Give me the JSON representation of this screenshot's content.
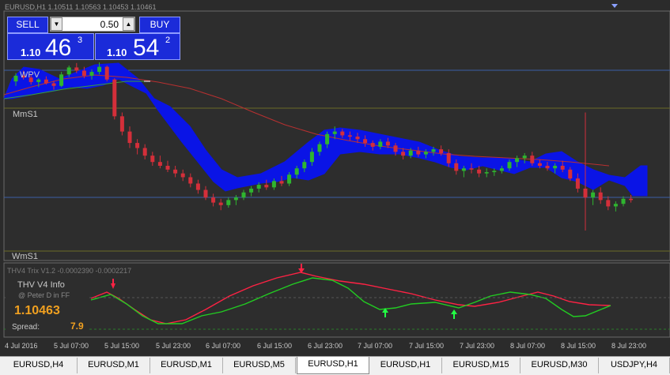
{
  "title": "EURUSD,H1  1.10511 1.10563 1.10453 1.10461",
  "trade_panel": {
    "sell_label": "SELL",
    "buy_label": "BUY",
    "lot_size": "0.50",
    "sell_price": {
      "prefix": "1.10",
      "big": "46",
      "sup": "3"
    },
    "buy_price": {
      "prefix": "1.10",
      "big": "54",
      "sup": "2"
    }
  },
  "levels": {
    "wpv": "WPV",
    "mms1": "MmS1",
    "wms1": "WmS1"
  },
  "indicator": {
    "header": "THV4 Trix V1.2 -0.0002390 -0.0002217",
    "info_title": "THV  V4  Info",
    "info_author": "@ Peter D in FF",
    "price": "1.10463",
    "spread_label": "Spread:",
    "spread_value": "7.9"
  },
  "time_axis": [
    "4 Jul 2016",
    "5 Jul 07:00",
    "5 Jul 15:00",
    "5 Jul 23:00",
    "6 Jul 07:00",
    "6 Jul 15:00",
    "6 Jul 23:00",
    "7 Jul 07:00",
    "7 Jul 15:00",
    "7 Jul 23:00",
    "8 Jul 07:00",
    "8 Jul 15:00",
    "8 Jul 23:00"
  ],
  "tabs": [
    "EURUSD,H4",
    "EURUSD,M1",
    "EURUSD,M1",
    "EURUSD,M5",
    "EURUSD,H1",
    "EURUSD,H1",
    "EURUSD,M15",
    "EURUSD,M30",
    "USDJPY,H4"
  ],
  "active_tab": 4,
  "colors": {
    "bull": "#2fb52f",
    "bear": "#d42f3a",
    "cloud": "#0a14e6",
    "level_line": "#3a5fa8",
    "trix_fast": "#ff2244",
    "trix_slow": "#22cc22"
  },
  "candles": [
    [
      1.1095,
      1.1108,
      1.1088,
      1.1104
    ],
    [
      1.1104,
      1.1112,
      1.1098,
      1.1101
    ],
    [
      1.1101,
      1.1105,
      1.109,
      1.1094
    ],
    [
      1.1094,
      1.11,
      1.1086,
      1.1098
    ],
    [
      1.1098,
      1.1103,
      1.109,
      1.1092
    ],
    [
      1.1092,
      1.1096,
      1.1082,
      1.1088
    ],
    [
      1.1088,
      1.111,
      1.1086,
      1.1106
    ],
    [
      1.1106,
      1.112,
      1.1102,
      1.1117
    ],
    [
      1.1117,
      1.1124,
      1.1108,
      1.1112
    ],
    [
      1.1112,
      1.1118,
      1.11,
      1.1104
    ],
    [
      1.1104,
      1.1114,
      1.1098,
      1.111
    ],
    [
      1.111,
      1.1125,
      1.1106,
      1.1118
    ],
    [
      1.1118,
      1.112,
      1.1095,
      1.1098
    ],
    [
      1.1098,
      1.11,
      1.1035,
      1.104
    ],
    [
      1.104,
      1.1046,
      1.101,
      1.1016
    ],
    [
      1.1016,
      1.1024,
      1.099,
      1.0998
    ],
    [
      1.0998,
      1.1004,
      1.098,
      1.099
    ],
    [
      1.099,
      1.0996,
      1.0972,
      1.0978
    ],
    [
      1.0978,
      1.0984,
      1.0962,
      1.0968
    ],
    [
      1.0968,
      1.0978,
      1.0958,
      1.0962
    ],
    [
      1.0962,
      1.097,
      1.0952,
      1.0956
    ],
    [
      1.0956,
      1.0962,
      1.0944,
      1.095
    ],
    [
      1.095,
      1.0956,
      1.0938,
      1.0944
    ],
    [
      1.0944,
      1.095,
      1.0928,
      1.0934
    ],
    [
      1.0934,
      1.094,
      1.0918,
      1.0924
    ],
    [
      1.0924,
      1.093,
      1.0908,
      1.0912
    ],
    [
      1.0912,
      1.0918,
      1.0898,
      1.0904
    ],
    [
      1.0904,
      1.091,
      1.0892,
      1.09
    ],
    [
      1.09,
      1.0912,
      1.0896,
      1.0908
    ],
    [
      1.0908,
      1.0916,
      1.09,
      1.0912
    ],
    [
      1.0912,
      1.0924,
      1.0908,
      1.092
    ],
    [
      1.092,
      1.093,
      1.0914,
      1.0926
    ],
    [
      1.0926,
      1.0936,
      1.092,
      1.0932
    ],
    [
      1.0932,
      1.094,
      1.0924,
      1.0928
    ],
    [
      1.0928,
      1.0942,
      1.0924,
      1.0938
    ],
    [
      1.0938,
      1.0946,
      1.093,
      1.0934
    ],
    [
      1.0934,
      1.0952,
      1.093,
      1.0948
    ],
    [
      1.0948,
      1.0962,
      1.0942,
      1.0958
    ],
    [
      1.0958,
      1.0972,
      1.0952,
      1.0968
    ],
    [
      1.0968,
      1.099,
      1.0962,
      1.0984
    ],
    [
      1.0984,
      1.1,
      1.0978,
      1.0996
    ],
    [
      1.0996,
      1.1016,
      1.099,
      1.1012
    ],
    [
      1.1012,
      1.1024,
      1.1004,
      1.1016
    ],
    [
      1.1016,
      1.102,
      1.1006,
      1.101
    ],
    [
      1.101,
      1.1016,
      1.1002,
      1.1008
    ],
    [
      1.1008,
      1.1014,
      1.0998,
      1.1004
    ],
    [
      1.1004,
      1.101,
      1.0992,
      1.0998
    ],
    [
      1.0998,
      1.1002,
      1.0986,
      1.0992
    ],
    [
      1.0992,
      1.1004,
      1.0988,
      1.1
    ],
    [
      1.1,
      1.1006,
      1.099,
      1.0994
    ],
    [
      1.0994,
      1.0998,
      1.0978,
      1.0984
    ],
    [
      1.0984,
      1.099,
      1.0972,
      1.0978
    ],
    [
      1.0978,
      1.099,
      1.0974,
      1.0986
    ],
    [
      1.0986,
      1.0992,
      1.0976,
      1.098
    ],
    [
      1.098,
      1.0988,
      1.0974,
      1.0984
    ],
    [
      1.0984,
      1.0992,
      1.0978,
      1.0988
    ],
    [
      1.0988,
      1.0994,
      1.0978,
      1.0982
    ],
    [
      1.0982,
      1.0988,
      1.096,
      1.0966
    ],
    [
      1.0966,
      1.0972,
      1.0948,
      1.0954
    ],
    [
      1.0954,
      1.0962,
      1.0944,
      1.0958
    ],
    [
      1.0958,
      1.0966,
      1.095,
      1.0956
    ],
    [
      1.0956,
      1.0962,
      1.0944,
      1.095
    ],
    [
      1.095,
      1.0958,
      1.0944,
      1.0952
    ],
    [
      1.0952,
      1.0958,
      1.0946,
      1.0954
    ],
    [
      1.0954,
      1.0962,
      1.095,
      1.0958
    ],
    [
      1.0958,
      1.0972,
      1.0954,
      1.0968
    ],
    [
      1.0968,
      1.0978,
      1.096,
      1.0974
    ],
    [
      1.0974,
      1.0982,
      1.0966,
      1.0978
    ],
    [
      1.0978,
      1.0984,
      1.0962,
      1.0966
    ],
    [
      1.0966,
      1.0972,
      1.0958,
      1.0962
    ],
    [
      1.0962,
      1.0968,
      1.0954,
      1.0958
    ],
    [
      1.0958,
      1.0966,
      1.095,
      1.0962
    ],
    [
      1.0962,
      1.097,
      1.0952,
      1.0956
    ],
    [
      1.0956,
      1.096,
      1.0938,
      1.0942
    ],
    [
      1.0942,
      1.095,
      1.092,
      1.0926
    ],
    [
      1.0926,
      1.1046,
      1.086,
      1.0912
    ],
    [
      1.0912,
      1.0924,
      1.09,
      1.092
    ],
    [
      1.092,
      1.0928,
      1.0902,
      1.0908
    ],
    [
      1.0908,
      1.0914,
      1.0892,
      1.0898
    ],
    [
      1.0898,
      1.0906,
      1.089,
      1.0902
    ],
    [
      1.0902,
      1.0914,
      1.0898,
      1.091
    ],
    [
      1.091,
      1.0916,
      1.0904,
      1.0908
    ]
  ]
}
